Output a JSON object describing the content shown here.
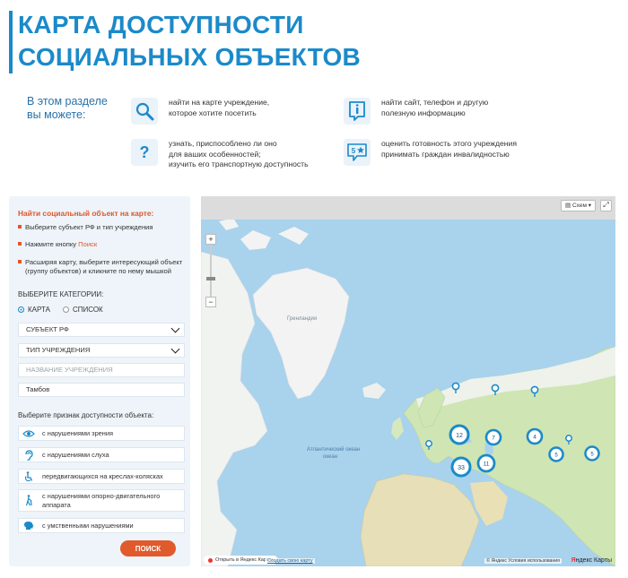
{
  "header": {
    "title_line1": "КАРТА ДОСТУПНОСТИ",
    "title_line2": "СОЦИАЛЬНЫХ ОБЪЕКТОВ",
    "intro_line1": "В этом разделе",
    "intro_line2": "вы можете:"
  },
  "features": [
    {
      "icon": "search-icon",
      "line1": "найти на карте учреждение,",
      "line2": "которое хотите посетить",
      "line3": ""
    },
    {
      "icon": "info-icon",
      "line1": "найти сайт, телефон и другую",
      "line2": "полезную информацию",
      "line3": ""
    },
    {
      "icon": "question-icon",
      "line1": "узнать, приспособлено ли оно",
      "line2": "для ваших особенностей;",
      "line3": "изучить его транспортную доступность"
    },
    {
      "icon": "rating-icon",
      "line1": "оценить готовность этого учреждения",
      "line2": "принимать граждан инвалидностью",
      "line3": ""
    }
  ],
  "panel": {
    "heading": "Найти социальный объект на карте:",
    "step1": "Выберите субъект РФ и тип учреждения",
    "step2_pre": "Нажмите кнопку ",
    "step2_hl": "Поиск",
    "step3": "Расширяя карту, выберите интересующий объект (группу объектов) и кликните по нему мышкой",
    "categories_heading": "ВЫБЕРИТЕ КАТЕГОРИИ:",
    "view_map": "КАРТА",
    "view_list": "СПИСОК",
    "subject_select": "СУБЪЕКТ РФ",
    "type_select": "ТИП УЧРЕЖДЕНИЯ",
    "name_placeholder": "НАЗВАНИЕ УЧРЕЖДЕНИЯ",
    "city_value": "Тамбов",
    "accessibility_heading": "Выберите признак доступности объекта:",
    "accessibility": [
      {
        "icon": "eye-icon",
        "label": "с нарушениями зрения"
      },
      {
        "icon": "ear-icon",
        "label": "с нарушениями слуха"
      },
      {
        "icon": "wheelchair-icon",
        "label": "передвигающихся на креслах-колясках"
      },
      {
        "icon": "walking-cane-icon",
        "label": "с нарушениями опорно-двигательного аппарата"
      },
      {
        "icon": "mind-icon",
        "label": "с умственными нарушениями"
      }
    ],
    "search_button": "ПОИСК"
  },
  "map": {
    "layers_button": "Схем",
    "open_in_yandex": "Открыть в Яндекс Картах",
    "create_map": "Создать свою карту",
    "terms": "© Яндекс Условия использования",
    "brand_pre": "Я",
    "brand_post": "ндекс Карты",
    "labels": {
      "greenland": "Гренландия",
      "atlantic": "Атлантический океан"
    },
    "clusters": [
      {
        "label": "12"
      },
      {
        "label": "7"
      },
      {
        "label": "4"
      },
      {
        "label": "33"
      },
      {
        "label": "11"
      },
      {
        "label": "5"
      },
      {
        "label": "5"
      }
    ]
  }
}
